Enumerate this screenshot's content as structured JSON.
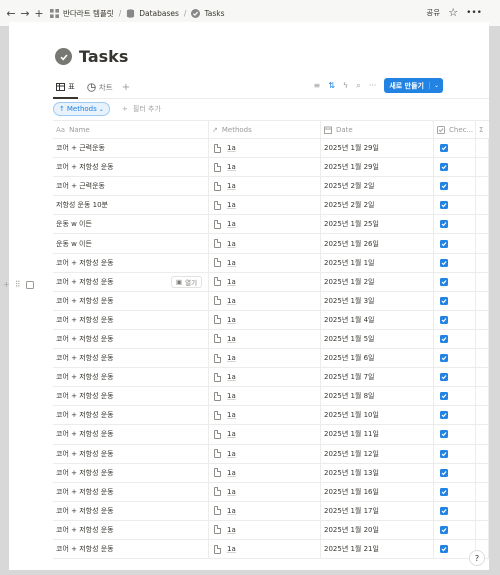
{
  "breadcrumb": {
    "workspace": "반다라트 템플릿",
    "databases": "Databases",
    "page": "Tasks"
  },
  "top_right": {
    "share": "공유"
  },
  "page": {
    "title": "Tasks"
  },
  "views": [
    {
      "label": "표",
      "icon": "table-icon",
      "active": true
    },
    {
      "label": "차트",
      "icon": "chart-icon",
      "active": false
    }
  ],
  "toolbar": {
    "new_label": "새로 만들기"
  },
  "filters": {
    "sort_chip": "Methods",
    "add_filter": "필터 추가"
  },
  "columns": {
    "name": "Name",
    "methods": "Methods",
    "date": "Date",
    "check": "Chec..."
  },
  "hover_row": {
    "open_label": "열기"
  },
  "rows": [
    {
      "name": "코어 + 근력운동",
      "methods": "1a",
      "date": "2025년 1월 29일",
      "checked": true
    },
    {
      "name": "코어 + 저항성 운동",
      "methods": "1a",
      "date": "2025년 1월 29일",
      "checked": true
    },
    {
      "name": "코어 + 근력운동",
      "methods": "1a",
      "date": "2025년 2월 2일",
      "checked": true
    },
    {
      "name": "저항성 운동 10분",
      "methods": "1a",
      "date": "2025년 2월 2일",
      "checked": true
    },
    {
      "name": "운동 w 이든",
      "methods": "1a",
      "date": "2025년 1월 25일",
      "checked": true
    },
    {
      "name": "운동 w 이든",
      "methods": "1a",
      "date": "2025년 1월 26일",
      "checked": true
    },
    {
      "name": "코어 + 저항성 운동",
      "methods": "1a",
      "date": "2025년 1월 1일",
      "checked": true
    },
    {
      "name": "코어 + 저항성 운동",
      "methods": "1a",
      "date": "2025년 1월 2일",
      "checked": true
    },
    {
      "name": "코어 + 저항성 운동",
      "methods": "1a",
      "date": "2025년 1월 3일",
      "checked": true
    },
    {
      "name": "코어 + 저항성 운동",
      "methods": "1a",
      "date": "2025년 1월 4일",
      "checked": true
    },
    {
      "name": "코어 + 저항성 운동",
      "methods": "1a",
      "date": "2025년 1월 5일",
      "checked": true
    },
    {
      "name": "코어 + 저항성 운동",
      "methods": "1a",
      "date": "2025년 1월 6일",
      "checked": true
    },
    {
      "name": "코어 + 저항성 운동",
      "methods": "1a",
      "date": "2025년 1월 7일",
      "checked": true
    },
    {
      "name": "코어 + 저항성 운동",
      "methods": "1a",
      "date": "2025년 1월 8일",
      "checked": true
    },
    {
      "name": "코어 + 저항성 운동",
      "methods": "1a",
      "date": "2025년 1월 10일",
      "checked": true
    },
    {
      "name": "코어 + 저항성 운동",
      "methods": "1a",
      "date": "2025년 1월 11일",
      "checked": true
    },
    {
      "name": "코어 + 저항성 운동",
      "methods": "1a",
      "date": "2025년 1월 12일",
      "checked": true
    },
    {
      "name": "코어 + 저항성 운동",
      "methods": "1a",
      "date": "2025년 1월 13일",
      "checked": true
    },
    {
      "name": "코어 + 저항성 운동",
      "methods": "1a",
      "date": "2025년 1월 16일",
      "checked": true
    },
    {
      "name": "코어 + 저항성 운동",
      "methods": "1a",
      "date": "2025년 1월 17일",
      "checked": true
    },
    {
      "name": "코어 + 저항성 운동",
      "methods": "1a",
      "date": "2025년 1월 20일",
      "checked": true
    },
    {
      "name": "코어 + 저항성 운동",
      "methods": "1a",
      "date": "2025년 1월 21일",
      "checked": true
    }
  ]
}
